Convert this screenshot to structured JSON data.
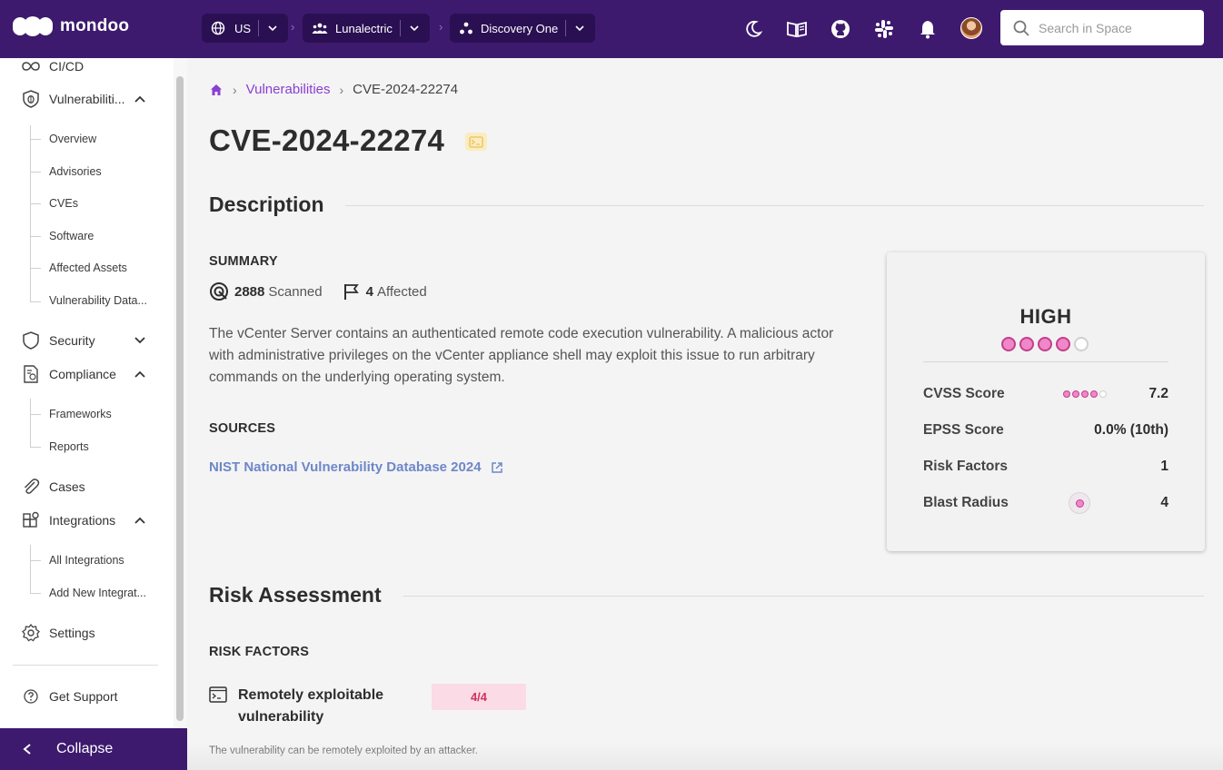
{
  "app": {
    "logo_text": "mondoo"
  },
  "topbar": {
    "region": "US",
    "org": "Lunalectric",
    "space": "Discovery One",
    "icons": [
      "moon-icon",
      "docs-book-icon",
      "github-icon",
      "slack-icon",
      "bell-icon"
    ],
    "search_placeholder": "Search in Space"
  },
  "sidebar": {
    "items": {
      "cicd": "CI/CD",
      "vulnerabilities": "Vulnerabiliti...",
      "vuln_sub": [
        "Overview",
        "Advisories",
        "CVEs",
        "Software",
        "Affected Assets",
        "Vulnerability Data..."
      ],
      "security": "Security",
      "compliance": "Compliance",
      "compliance_sub": [
        "Frameworks",
        "Reports"
      ],
      "cases": "Cases",
      "integrations": "Integrations",
      "integrations_sub": [
        "All Integrations",
        "Add New Integrat..."
      ],
      "settings": "Settings",
      "support": "Get Support"
    },
    "collapse_label": "Collapse"
  },
  "breadcrumb": {
    "section": "Vulnerabilities",
    "current": "CVE-2024-22274"
  },
  "page": {
    "title": "CVE-2024-22274"
  },
  "description": {
    "heading": "Description",
    "summary_label": "SUMMARY",
    "scanned_count": "2888",
    "scanned_label": "Scanned",
    "affected_count": "4",
    "affected_label": "Affected",
    "text": "The vCenter Server contains an authenticated remote code execution vulnerability. A malicious actor with administrative privileges on the vCenter appliance shell may exploit this issue to run arbitrary commands on the underlying operating system.",
    "sources_label": "SOURCES",
    "source_link": "NIST National Vulnerability Database 2024"
  },
  "score_card": {
    "severity": "HIGH",
    "severity_level": 4,
    "severity_max": 5,
    "rows": [
      {
        "key": "CVSS Score",
        "value": "7.2"
      },
      {
        "key": "EPSS Score",
        "value": "0.0% (10th)"
      },
      {
        "key": "Risk Factors",
        "value": "1"
      },
      {
        "key": "Blast Radius",
        "value": "4"
      }
    ],
    "accent_color": "#f087c8"
  },
  "risk": {
    "heading": "Risk Assessment",
    "factors_label": "RISK FACTORS",
    "factor_name": "Remotely exploitable vulnerability",
    "factor_badge": "4/4",
    "factor_note": "The vulnerability can be remotely exploited by an attacker."
  },
  "colors": {
    "brand": "#3d1a6e",
    "link": "#8a3fd0",
    "source_link": "#6d87c9",
    "badge_text": "#d0335e"
  }
}
